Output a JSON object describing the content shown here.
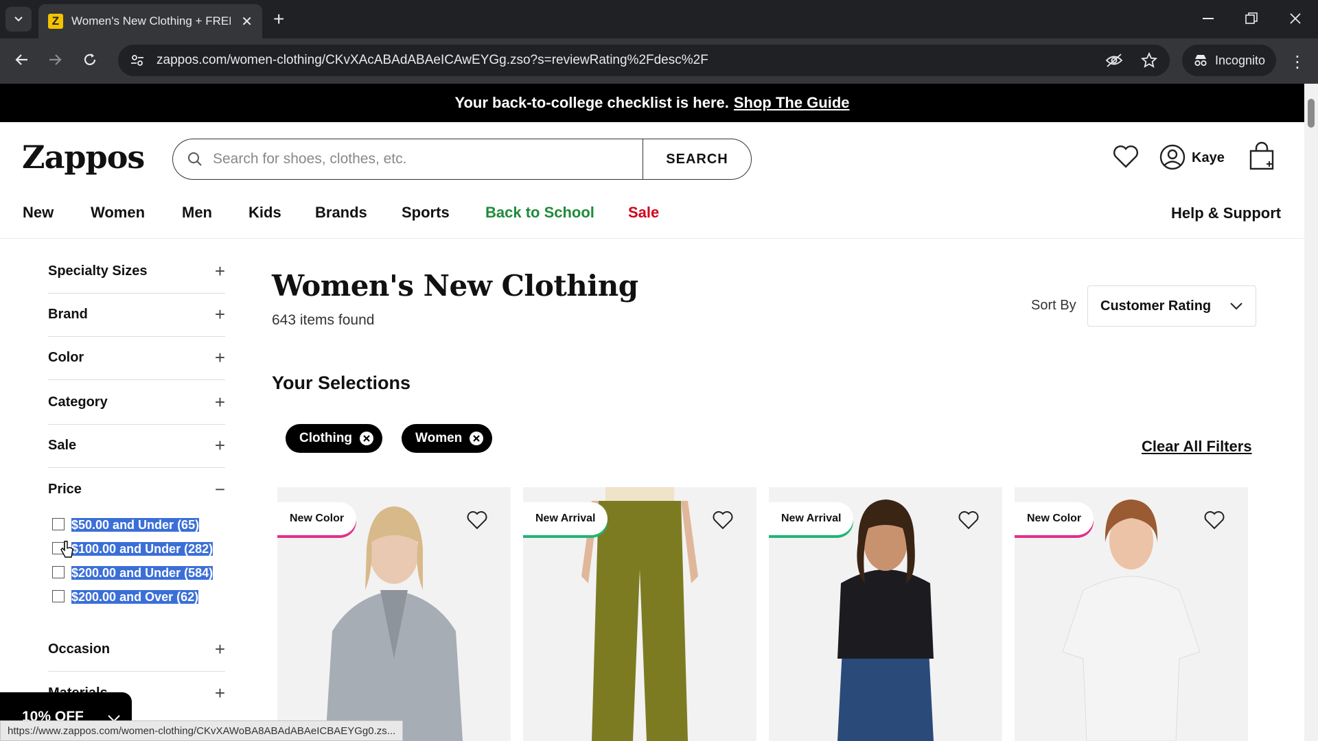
{
  "browser": {
    "tab_title": "Women's New Clothing + FREE",
    "favicon_letter": "Z",
    "url": "zappos.com/women-clothing/CKvXAcABAdABAeICAwEYGg.zso?s=reviewRating%2Fdesc%2F",
    "incognito_label": "Incognito",
    "status_url": "https://www.zappos.com/women-clothing/CKvXAWoBA8ABAdABAeICBAEYGg0.zs..."
  },
  "promo": {
    "text": "Your back-to-college checklist is here.",
    "link": "Shop The Guide"
  },
  "header": {
    "logo": "Zappos",
    "search_placeholder": "Search for shoes, clothes, etc.",
    "search_button": "SEARCH",
    "user_name": "Kaye"
  },
  "nav": {
    "items": [
      "New",
      "Women",
      "Men",
      "Kids",
      "Brands",
      "Sports",
      "Back to School",
      "Sale"
    ],
    "help": "Help & Support",
    "colors": {
      "back_to_school": "#1f8a3a",
      "sale": "#d0021b"
    }
  },
  "filters": {
    "facets": [
      "Specialty Sizes",
      "Brand",
      "Color",
      "Category",
      "Sale",
      "Price",
      "Occasion",
      "Materials"
    ],
    "price_options": [
      "$50.00 and Under (65)",
      "$100.00 and Under (282)",
      "$200.00 and Under (584)",
      "$200.00 and Over (62)"
    ]
  },
  "discount_tab": "10% OFF",
  "main": {
    "title": "Women's New Clothing",
    "count": "643 items found",
    "sort_label": "Sort By",
    "sort_value": "Customer Rating",
    "selections_title": "Your Selections",
    "chips": [
      "Clothing",
      "Women"
    ],
    "clear_all": "Clear All Filters"
  },
  "products": [
    {
      "badge": "New Color",
      "color": "#9aa0a8"
    },
    {
      "badge": "New Arrival",
      "color": "#7a7a1f"
    },
    {
      "badge": "New Arrival",
      "color": "#1e1e22"
    },
    {
      "badge": "New Color",
      "color": "#f0f0f0"
    }
  ]
}
